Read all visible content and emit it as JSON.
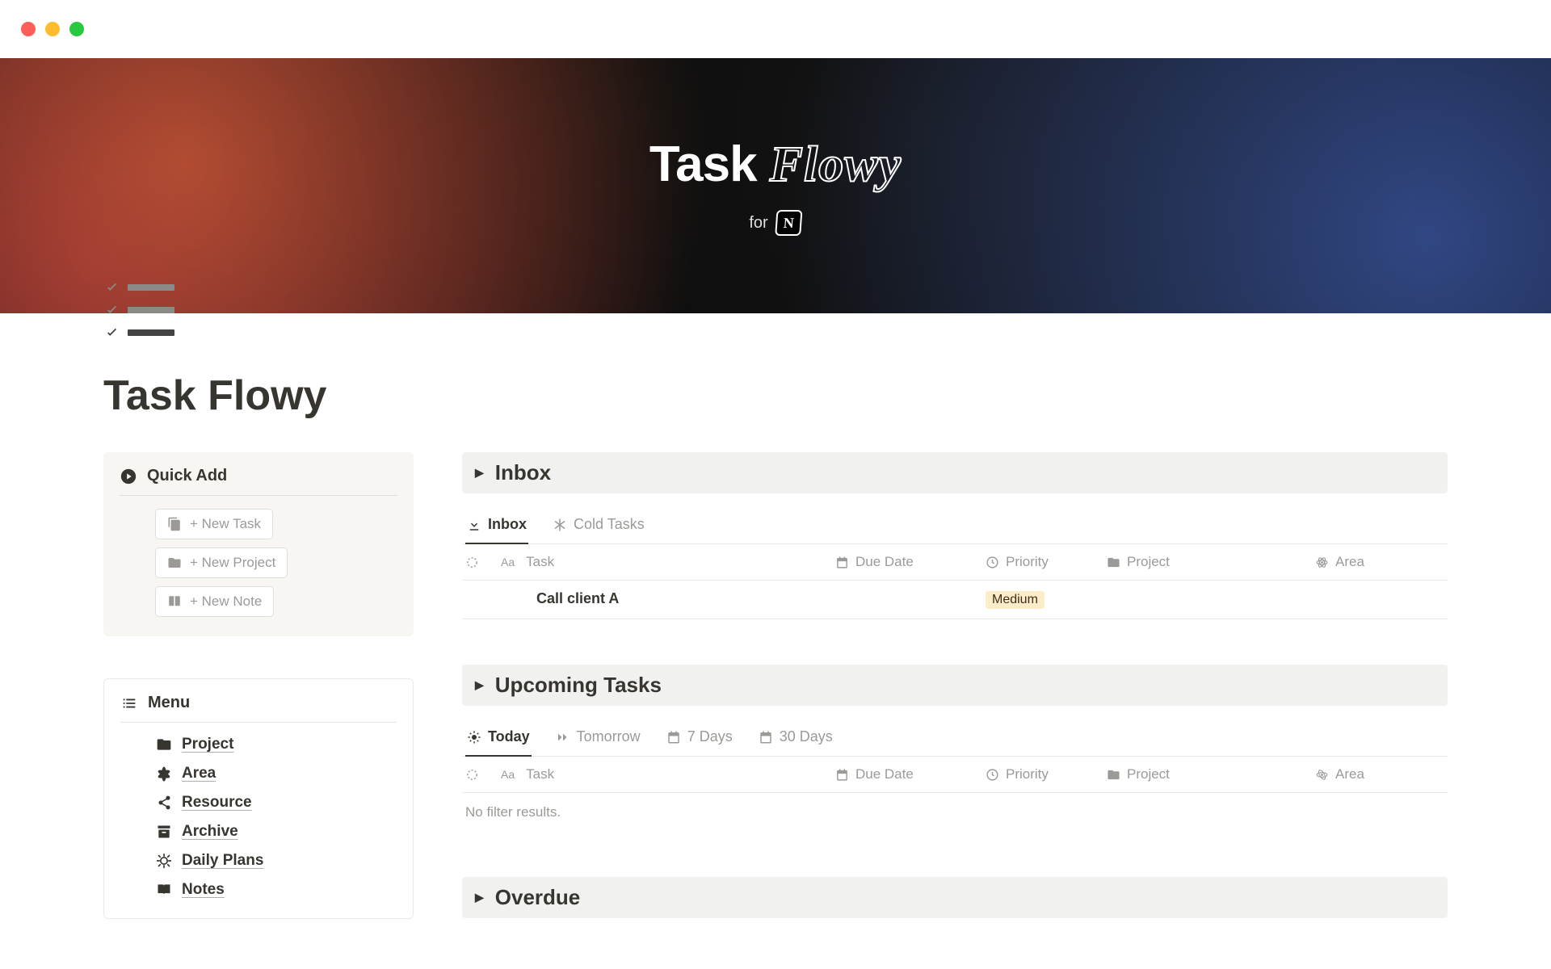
{
  "cover": {
    "title_solid": "Task",
    "title_outline": "Flowy",
    "for_label": "for",
    "logo_letter": "N"
  },
  "page": {
    "title": "Task Flowy"
  },
  "quick_add": {
    "header": "Quick Add",
    "buttons": {
      "new_task": "+ New Task",
      "new_project": "+ New Project",
      "new_note": "+ New Note"
    }
  },
  "menu": {
    "header": "Menu",
    "items": {
      "project": "Project",
      "area": "Area",
      "resource": "Resource",
      "archive": "Archive",
      "daily_plans": "Daily Plans",
      "notes": "Notes"
    }
  },
  "inbox_section": {
    "title": "Inbox",
    "tabs": {
      "inbox": "Inbox",
      "cold": "Cold Tasks"
    },
    "columns": {
      "task": "Task",
      "due": "Due Date",
      "priority": "Priority",
      "project": "Project",
      "area": "Area"
    },
    "row1": {
      "task": "Call client A",
      "priority": "Medium"
    }
  },
  "upcoming_section": {
    "title": "Upcoming Tasks",
    "tabs": {
      "today": "Today",
      "tomorrow": "Tomorrow",
      "seven": "7 Days",
      "thirty": "30 Days"
    },
    "columns": {
      "task": "Task",
      "due": "Due Date",
      "priority": "Priority",
      "project": "Project",
      "area": "Area"
    },
    "empty": "No filter results."
  },
  "overdue_section": {
    "title": "Overdue"
  }
}
